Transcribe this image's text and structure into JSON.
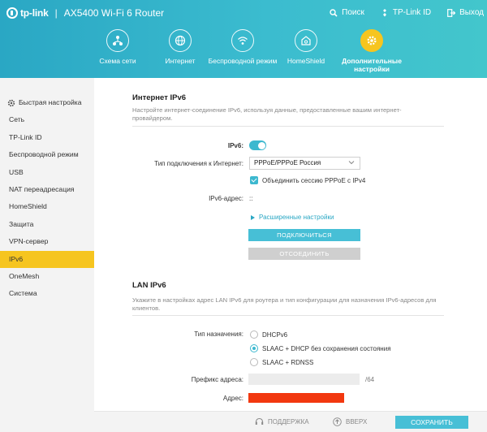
{
  "header": {
    "logo": "tp-link",
    "separator": "|",
    "model": "AX5400 Wi-Fi 6 Router",
    "actions": [
      {
        "icon": "search-icon",
        "label": "Поиск"
      },
      {
        "icon": "tplink-id-icon",
        "label": "TP-Link ID"
      },
      {
        "icon": "logout-icon",
        "label": "Выход"
      }
    ],
    "nav": [
      {
        "icon": "network-map-icon",
        "label": "Схема сети"
      },
      {
        "icon": "globe-icon",
        "label": "Интернет"
      },
      {
        "icon": "wifi-icon",
        "label": "Беспроводной режим"
      },
      {
        "icon": "homeshield-icon",
        "label": "HomeShield"
      },
      {
        "icon": "gear-icon",
        "label": "Дополнительные настройки"
      }
    ],
    "accent": "#f6c51f",
    "brand_color": "#3bbccf"
  },
  "sidebar": {
    "items": [
      "Быстрая настройка",
      "Сеть",
      "TP-Link ID",
      "Беспроводной режим",
      "USB",
      "NAT переадресация",
      "HomeShield",
      "Защита",
      "VPN-сервер",
      "IPv6",
      "OneMesh",
      "Система"
    ],
    "active": "IPv6"
  },
  "internet_ipv6": {
    "title": "Интернет IPv6",
    "description": "Настройте интернет-соединение IPv6, используя данные, предоставленные вашим интернет-провайдером.",
    "ipv6_label": "IPv6:",
    "ipv6_enabled": true,
    "conn_type_label": "Тип подключения к Интернет:",
    "conn_type_value": "PPPoE/PPPoE Россия",
    "merge_label": "Объединить сессию PPPoE с IPv4",
    "merge_checked": true,
    "address_label": "IPv6-адрес:",
    "address_value": "::",
    "advanced_link": "Расширенные настройки",
    "connect_button": "ПОДКЛЮЧИТЬСЯ",
    "disconnect_button": "ОТСОЕДИНИТЬ"
  },
  "lan_ipv6": {
    "title": "LAN IPv6",
    "description": "Укажите в настройках адрес LAN IPv6 для роутера и тип конфигурации для назначения IPv6-адресов для клиентов.",
    "assign_label": "Тип назначения:",
    "options": [
      "DHCPv6",
      "SLAAC + DHCP без сохранения состояния",
      "SLAAC + RDNSS"
    ],
    "selected": "SLAAC + DHCP без сохранения состояния",
    "prefix_label": "Префикс адреса:",
    "prefix_suffix": "/64",
    "address_label": "Адрес:",
    "redact_color": "#f2380f"
  },
  "footer": {
    "support": "ПОДДЕРЖКА",
    "top": "ВВЕРХ",
    "save": "СОХРАНИТЬ"
  }
}
